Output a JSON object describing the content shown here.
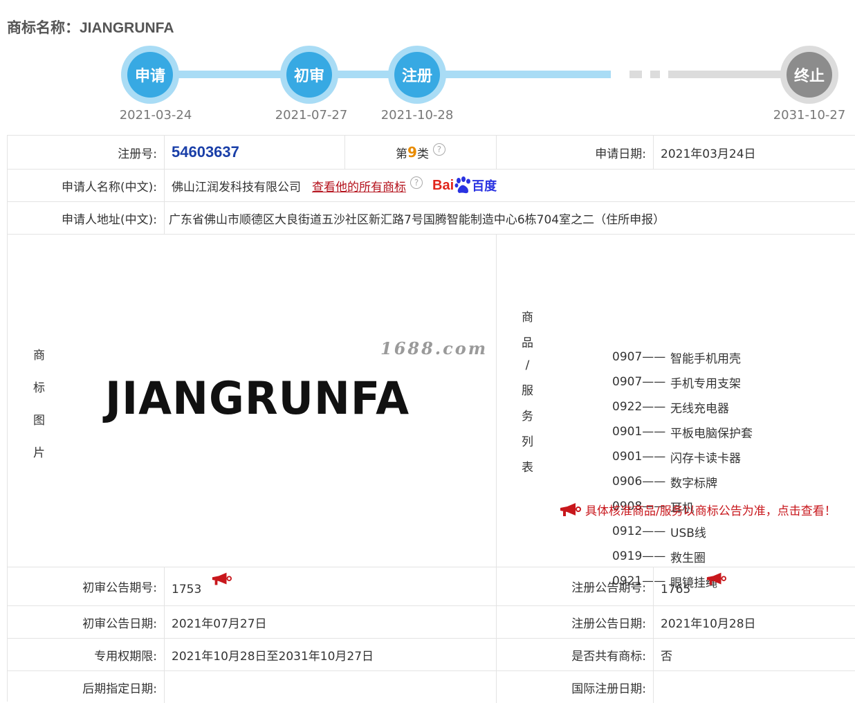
{
  "title": {
    "label": "商标名称：",
    "name": "JIANGRUNFA"
  },
  "timeline": [
    {
      "label": "申请",
      "date": "2021-03-24"
    },
    {
      "label": "初审",
      "date": "2021-07-27"
    },
    {
      "label": "注册",
      "date": "2021-10-28"
    },
    {
      "label": "终止",
      "date": "2031-10-27"
    }
  ],
  "rows": {
    "reg_no_label": "注册号:",
    "reg_no": "54603637",
    "class_prefix": "第",
    "class_no": "9",
    "class_suffix": "类",
    "apply_date_label": "申请日期:",
    "apply_date": "2021年03月24日",
    "applicant_label": "申请人名称(中文):",
    "applicant": "佛山江润发科技有限公司",
    "all_marks_link": "查看他的所有商标",
    "baidu_red": "Bai",
    "baidu_blue": "百度",
    "address_label": "申请人地址(中文):",
    "address": "广东省佛山市顺德区大良街道五沙社区新汇路7号国腾智能制造中心6栋704室之二（住所申报）",
    "image_label": [
      "商",
      "标",
      "图",
      "片"
    ],
    "mark_text": "JIANGRUNFA",
    "watermark": "1688.com",
    "goods_label": [
      "商",
      "品",
      "/",
      "服",
      "务",
      "列",
      "表"
    ],
    "goods": [
      {
        "code": "0907——",
        "name": "智能手机用壳"
      },
      {
        "code": "0907——",
        "name": "手机专用支架"
      },
      {
        "code": "0922——",
        "name": "无线充电器"
      },
      {
        "code": "0901——",
        "name": "平板电脑保护套"
      },
      {
        "code": "0901——",
        "name": "闪存卡读卡器"
      },
      {
        "code": "0906——",
        "name": "数字标牌"
      },
      {
        "code": "0908——",
        "name": "耳机"
      },
      {
        "code": "0912——",
        "name": "USB线"
      },
      {
        "code": "0919——",
        "name": "救生圈"
      },
      {
        "code": "0921——",
        "name": "眼镜挂绳"
      }
    ],
    "goods_notice": "具体核准商品/服务以商标公告为准，点击查看！",
    "prelim_no_label": "初审公告期号:",
    "prelim_no": "1753",
    "reg_pub_no_label": "注册公告期号:",
    "reg_pub_no": "1765",
    "prelim_date_label": "初审公告日期:",
    "prelim_date": "2021年07月27日",
    "reg_pub_date_label": "注册公告日期:",
    "reg_pub_date": "2021年10月28日",
    "term_label": "专用权期限:",
    "term": "2021年10月28日至2031年10月27日",
    "shared_label": "是否共有商标:",
    "shared": "否",
    "later_label": "后期指定日期:",
    "later": "",
    "intl_label": "国际注册日期:",
    "intl": ""
  },
  "colors": {
    "accent_blue": "#37a9e3",
    "track_blue": "#a9dcf5",
    "link_red": "#b4121c",
    "reg_no_blue": "#1a3fa8"
  }
}
